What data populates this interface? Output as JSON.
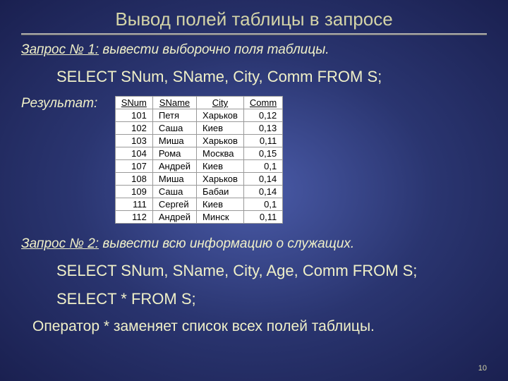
{
  "title": "Вывод полей таблицы в запросе",
  "query1": {
    "label_prefix": "Запрос № 1:",
    "label_text": " вывести выборочно поля таблицы.",
    "sql": "SELECT SNum, SName, City, Comm FROM  S;"
  },
  "result_label": "Результат:",
  "table": {
    "headers": [
      "SNum",
      "SName",
      "City",
      "Comm"
    ],
    "rows": [
      [
        "101",
        "Петя",
        "Харьков",
        "0,12"
      ],
      [
        "102",
        "Саша",
        "Киев",
        "0,13"
      ],
      [
        "103",
        "Миша",
        "Харьков",
        "0,11"
      ],
      [
        "104",
        "Рома",
        "Москва",
        "0,15"
      ],
      [
        "107",
        "Андрей",
        "Киев",
        "0,1"
      ],
      [
        "108",
        "Миша",
        "Харьков",
        "0,14"
      ],
      [
        "109",
        "Саша",
        "Бабаи",
        "0,14"
      ],
      [
        "111",
        "Сергей",
        "Киев",
        "0,1"
      ],
      [
        "112",
        "Андрей",
        "Минск",
        "0,11"
      ]
    ]
  },
  "query2": {
    "label_prefix": "Запрос № 2:",
    "label_text": " вывести всю информацию о служащих.",
    "sql1": "SELECT SNum, SName, City, Age, Comm FROM  S;",
    "sql2": "SELECT * FROM  S;"
  },
  "footnote": "Оператор  *   заменяет список всех полей таблицы.",
  "pagenum": "10"
}
